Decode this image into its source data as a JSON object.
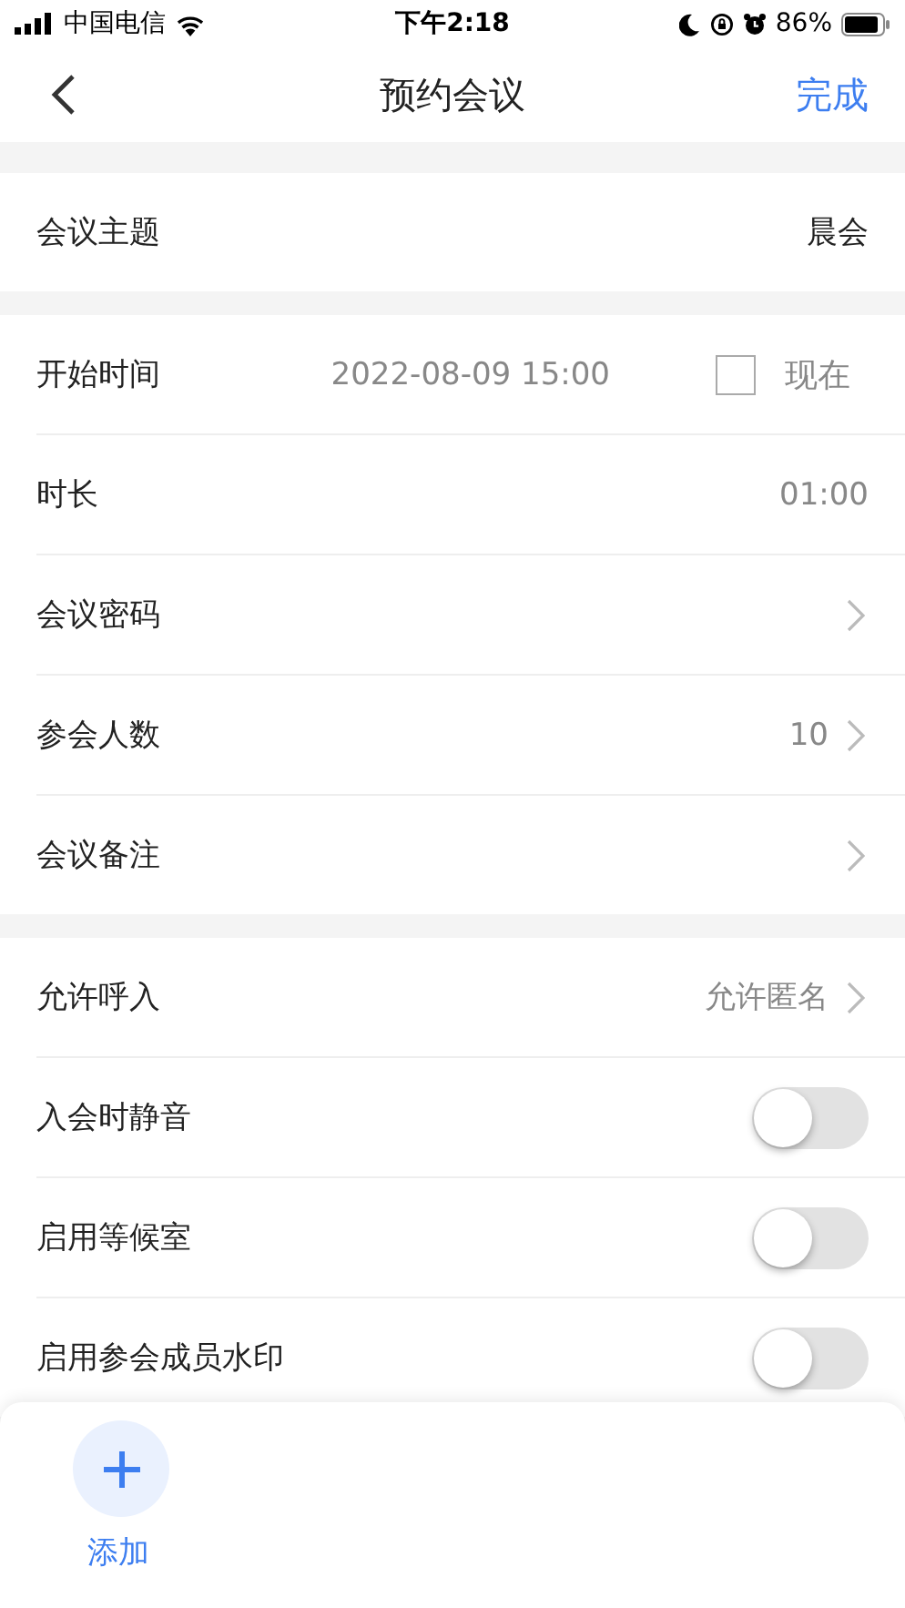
{
  "status_bar": {
    "carrier": "中国电信",
    "time": "下午2:18",
    "battery": "86%"
  },
  "nav": {
    "title": "预约会议",
    "action": "完成"
  },
  "sections": [
    [
      {
        "kind": "text",
        "label": "会议主题",
        "value": "晨会"
      }
    ],
    [
      {
        "kind": "time",
        "label": "开始时间",
        "value": "2022-08-09 15:00",
        "checkbox_label": "现在",
        "checked": false
      },
      {
        "kind": "text",
        "label": "时长",
        "value": "01:00"
      },
      {
        "kind": "link",
        "label": "会议密码"
      },
      {
        "kind": "link",
        "label": "参会人数",
        "value": "10"
      },
      {
        "kind": "link",
        "label": "会议备注"
      }
    ],
    [
      {
        "kind": "link",
        "label": "允许呼入",
        "value": "允许匿名"
      },
      {
        "kind": "toggle",
        "label": "入会时静音",
        "on": false
      },
      {
        "kind": "toggle",
        "label": "启用等候室",
        "on": false
      },
      {
        "kind": "toggle",
        "label": "启用参会成员水印",
        "on": false
      }
    ]
  ],
  "add_button": {
    "label": "添加"
  }
}
